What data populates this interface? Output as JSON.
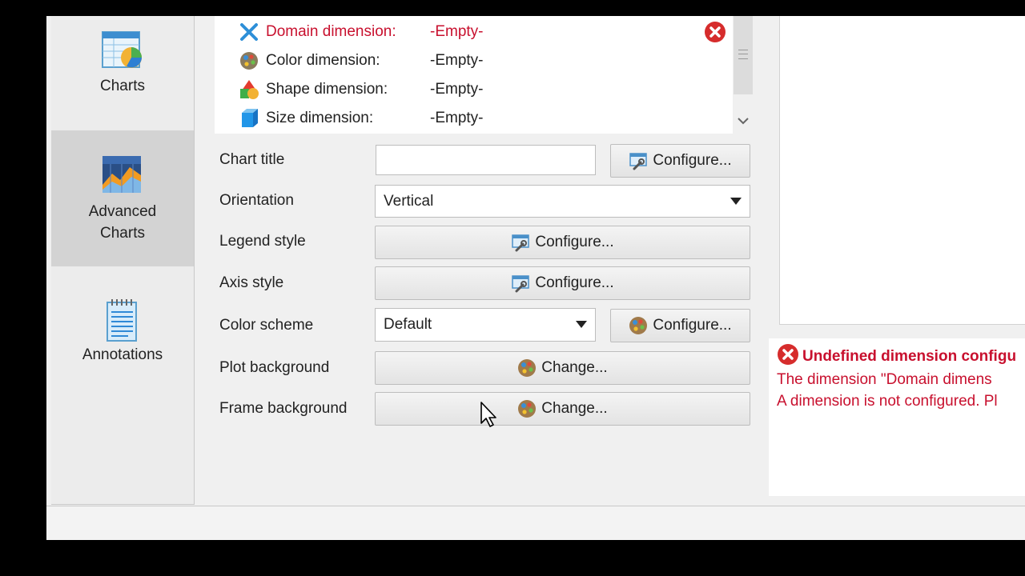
{
  "sidebar": {
    "items": [
      {
        "label": "Charts",
        "icon": "charts-icon"
      },
      {
        "label": "Advanced\nCharts",
        "icon": "advanced-charts-icon",
        "active": true
      },
      {
        "label": "Annotations",
        "icon": "annotations-icon"
      }
    ]
  },
  "dimensions": [
    {
      "name": "Domain dimension:",
      "value": "-Empty-",
      "icon": "x-icon",
      "error": true
    },
    {
      "name": "Color dimension:",
      "value": "-Empty-",
      "icon": "palette-icon"
    },
    {
      "name": "Shape dimension:",
      "value": "-Empty-",
      "icon": "shapes-icon"
    },
    {
      "name": "Size dimension:",
      "value": "-Empty-",
      "icon": "cube-icon"
    }
  ],
  "form": {
    "chart_title": {
      "label": "Chart title",
      "value": "",
      "button": "Configure..."
    },
    "orientation": {
      "label": "Orientation",
      "value": "Vertical"
    },
    "legend_style": {
      "label": "Legend style",
      "button": "Configure..."
    },
    "axis_style": {
      "label": "Axis style",
      "button": "Configure..."
    },
    "color_scheme": {
      "label": "Color scheme",
      "value": "Default",
      "button": "Configure..."
    },
    "plot_background": {
      "label": "Plot background",
      "button": "Change..."
    },
    "frame_background": {
      "label": "Frame background",
      "button": "Change..."
    }
  },
  "messages": {
    "title": "Undefined dimension configu",
    "line1": "The dimension \"Domain dimens",
    "line2": "A dimension is not configured. Pl"
  },
  "colors": {
    "error": "#c8102e",
    "sidebar_active": "#d3d3d3",
    "background": "#f0f0f0"
  }
}
